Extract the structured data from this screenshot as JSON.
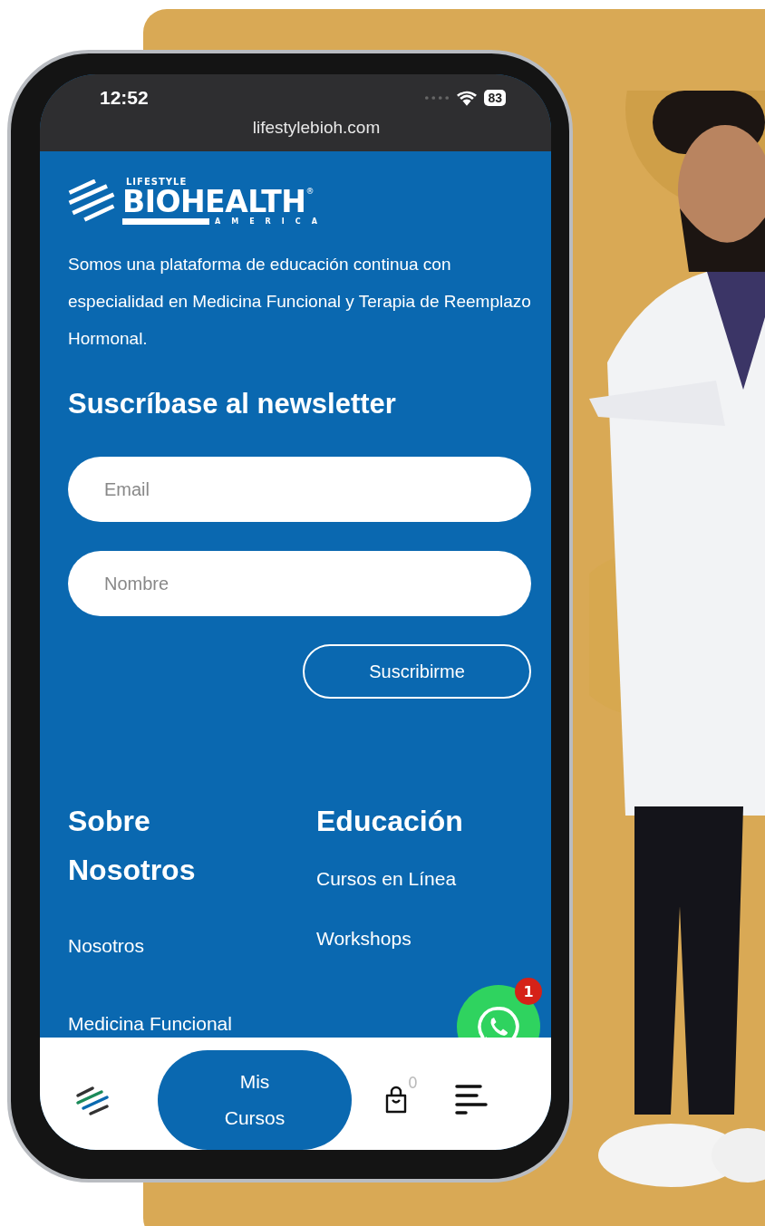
{
  "status_bar": {
    "time": "12:52",
    "battery": "83"
  },
  "browser": {
    "url": "lifestylebioh.com"
  },
  "logo": {
    "top": "LIFESTYLE",
    "name": "BIOHEALTH",
    "mark": "®",
    "bottom": "AMERICA"
  },
  "description": "Somos una plataforma de educación continua con especialidad en Medicina Funcional y Terapia de Reemplazo Hormonal.",
  "newsletter": {
    "heading": "Suscríbase al newsletter",
    "fields": [
      {
        "placeholder": "Email"
      },
      {
        "placeholder": "Nombre"
      }
    ],
    "button": "Suscribirme"
  },
  "footer_columns": [
    {
      "heading": "Sobre Nosotros",
      "links": [
        "Nosotros",
        "Medicina Funcional"
      ]
    },
    {
      "heading": "Educación",
      "links": [
        "Cursos en Línea",
        "Workshops"
      ]
    }
  ],
  "whatsapp": {
    "badge": "1"
  },
  "bottom_nav": {
    "button": "Mis Cursos",
    "cart_count": "0"
  }
}
